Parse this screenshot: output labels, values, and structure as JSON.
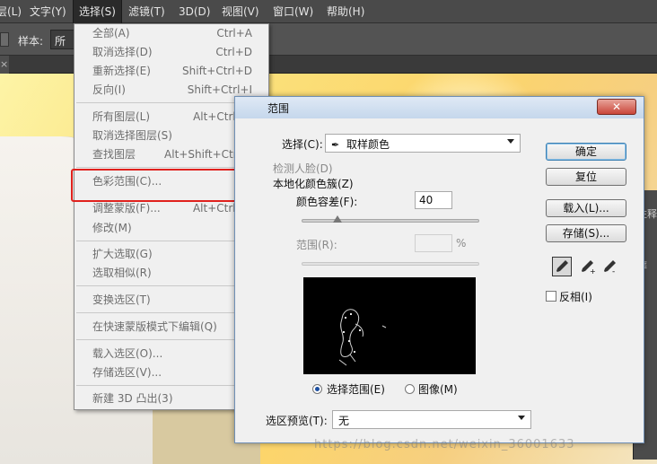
{
  "menubar": [
    "层(L)",
    "文字(Y)",
    "选择(S)",
    "滤镜(T)",
    "3D(D)",
    "视图(V)",
    "窗口(W)",
    "帮助(H)"
  ],
  "options_bar": {
    "sample_label": "样本:",
    "sample_value": "所有"
  },
  "select_menu": {
    "items": [
      {
        "label": "全部(A)",
        "shortcut": "Ctrl+A"
      },
      {
        "label": "取消选择(D)",
        "shortcut": "Ctrl+D"
      },
      {
        "label": "重新选择(E)",
        "shortcut": "Shift+Ctrl+D"
      },
      {
        "label": "反向(I)",
        "shortcut": "Shift+Ctrl+I"
      },
      {
        "label": "所有图层(L)",
        "shortcut": "Alt+Ctrl+A"
      },
      {
        "label": "取消选择图层(S)",
        "shortcut": ""
      },
      {
        "label": "查找图层",
        "shortcut": "Alt+Shift+Ctrl+F"
      },
      {
        "label": "色彩范围(C)...",
        "shortcut": ""
      },
      {
        "label": "调整蒙版(F)...",
        "shortcut": "Alt+Ctrl+R"
      },
      {
        "label": "修改(M)",
        "shortcut": ""
      },
      {
        "label": "扩大选取(G)",
        "shortcut": ""
      },
      {
        "label": "选取相似(R)",
        "shortcut": ""
      },
      {
        "label": "变换选区(T)",
        "shortcut": ""
      },
      {
        "label": "在快速蒙版模式下编辑(Q)",
        "shortcut": ""
      },
      {
        "label": "载入选区(O)...",
        "shortcut": ""
      },
      {
        "label": "存储选区(V)...",
        "shortcut": ""
      },
      {
        "label": "新建 3D 凸出(3)",
        "shortcut": ""
      }
    ]
  },
  "dialog": {
    "title": "范围",
    "close": "✕",
    "select_label": "选择(C):",
    "select_value": "取样颜色",
    "detect_faces": "检测人脸(D)",
    "localized": "本地化颜色簇(Z)",
    "fuzziness_label": "颜色容差(F):",
    "fuzziness_value": "40",
    "fuzziness_level": 40,
    "range_label": "范围(R):",
    "range_unit": "%",
    "radio_selection": "选择范围(E)",
    "radio_image": "图像(M)",
    "preview_label": "选区预览(T):",
    "preview_value": "无",
    "buttons": {
      "ok": "确定",
      "reset": "复位",
      "load": "载入(L)...",
      "save": "存储(S)..."
    },
    "invert": "反相(I)"
  },
  "right_panel": [
    "注释",
    "葬"
  ],
  "watermark": "https://blog.csdn.net/weixin_36001633"
}
